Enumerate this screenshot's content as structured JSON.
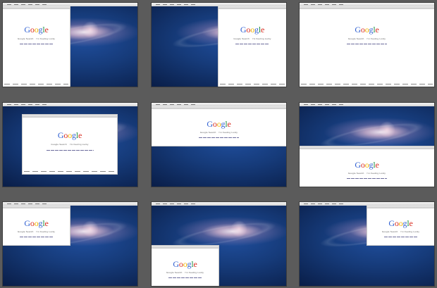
{
  "page": {
    "background": "#5b5b5b"
  },
  "browser": {
    "logo": [
      "G",
      "o",
      "o",
      "g",
      "l",
      "e"
    ],
    "search_button": "Google Search",
    "lucky_button": "I'm Feeling Lucky"
  },
  "panels": [
    {
      "label": "left-half"
    },
    {
      "label": "right-half"
    },
    {
      "label": "full-screen"
    },
    {
      "label": "centered"
    },
    {
      "label": "top-half"
    },
    {
      "label": "bottom-half"
    },
    {
      "label": "top-left-quarter"
    },
    {
      "label": "bottom-left-quarter"
    },
    {
      "label": "top-right-quarter"
    }
  ]
}
